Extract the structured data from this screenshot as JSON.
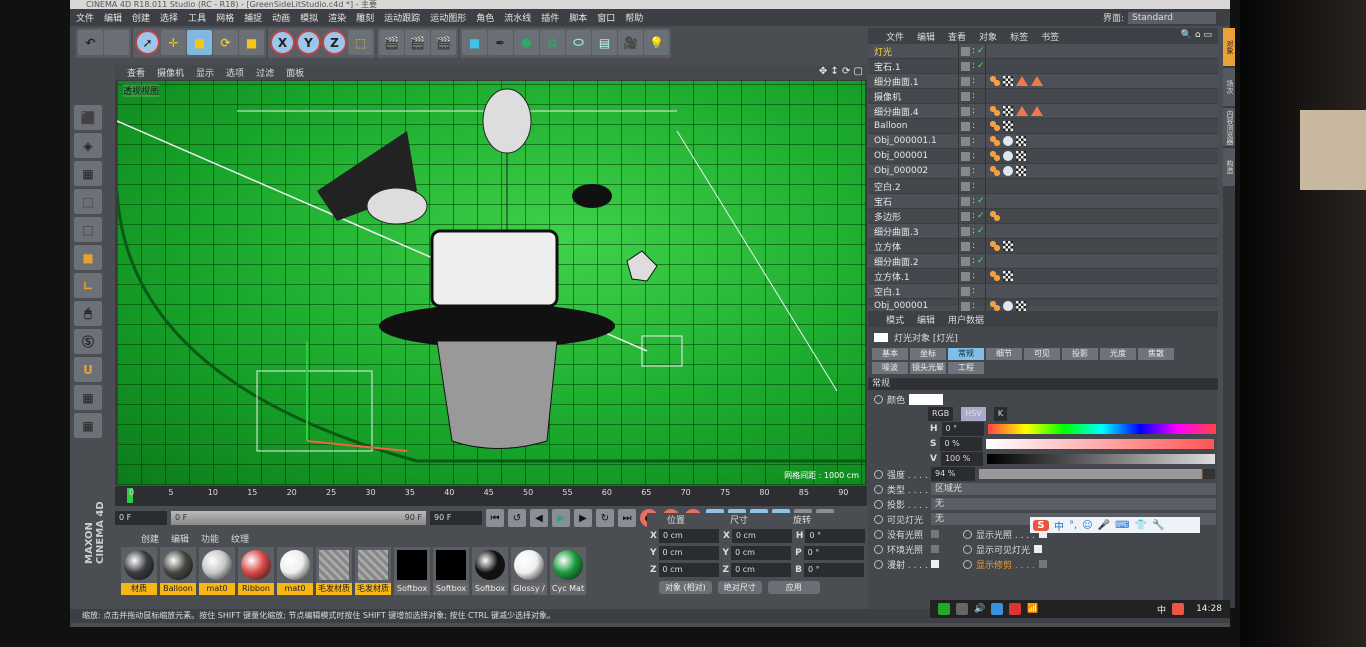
{
  "window": {
    "title": "CINEMA 4D R18.011 Studio (RC - R18) - [GreenSideLitStudio.c4d *] - 主要"
  },
  "menu": [
    "文件",
    "编辑",
    "创建",
    "选择",
    "工具",
    "网格",
    "捕捉",
    "动画",
    "模拟",
    "渲染",
    "雕刻",
    "运动跟踪",
    "运动图形",
    "角色",
    "流水线",
    "插件",
    "脚本",
    "窗口",
    "帮助"
  ],
  "layout": {
    "label": "界面:",
    "value": "Standard"
  },
  "toolbar": {
    "axes": [
      "X",
      "Y",
      "Z"
    ]
  },
  "viewport": {
    "menu": [
      "查看",
      "摄像机",
      "显示",
      "选项",
      "过滤",
      "面板"
    ],
    "label": "透视视图",
    "grid_spacing": "网格间距 : 1000 cm",
    "bg_color": "#22b534"
  },
  "timeline": {
    "ticks": [
      "0",
      "5",
      "10",
      "15",
      "20",
      "25",
      "30",
      "35",
      "40",
      "45",
      "50",
      "55",
      "60",
      "65",
      "70",
      "75",
      "80",
      "85",
      "90"
    ],
    "current_frame": "0 F",
    "start": "0 F",
    "slider_start": "0 F",
    "slider_end": "90 F",
    "end": "90 F"
  },
  "materials": {
    "menu": [
      "创建",
      "编辑",
      "功能",
      "纹理"
    ],
    "items": [
      {
        "name": "材质",
        "color": "#3a3c40",
        "sel": true
      },
      {
        "name": "Balloon",
        "color": "#45483f",
        "sel": true
      },
      {
        "name": "mat0",
        "color": "#c8c8c8",
        "sel": true
      },
      {
        "name": "Ribbon",
        "color": "#d84848",
        "sel": true
      },
      {
        "name": "mat0",
        "color": "#eeeeee",
        "sel": true
      },
      {
        "name": "毛发材质",
        "color": "hair",
        "sel": true
      },
      {
        "name": "毛发材质",
        "color": "hair",
        "sel": true
      },
      {
        "name": "Softbox",
        "color": "#000000",
        "sel": false
      },
      {
        "name": "Softbox",
        "color": "#000000",
        "sel": false
      },
      {
        "name": "Softbox",
        "color": "#111111",
        "sel": false
      },
      {
        "name": "Glossy /",
        "color": "#f0f0f0",
        "sel": false
      },
      {
        "name": "Cyc Mat",
        "color": "#1a9a3a",
        "sel": false
      }
    ]
  },
  "logo": "MAXON CINEMA 4D",
  "coords": {
    "headers": [
      "位置",
      "尺寸",
      "旋转"
    ],
    "rows": [
      {
        "a": "X",
        "av": "0 cm",
        "b": "X",
        "bv": "0 cm",
        "c": "H",
        "cv": "0 °"
      },
      {
        "a": "Y",
        "av": "0 cm",
        "b": "Y",
        "bv": "0 cm",
        "c": "P",
        "cv": "0 °"
      },
      {
        "a": "Z",
        "av": "0 cm",
        "b": "Z",
        "bv": "0 cm",
        "c": "B",
        "cv": "0 °"
      }
    ],
    "mode": "对象 (相对)",
    "size_mode": "绝对尺寸",
    "apply": "应用"
  },
  "status": "缩放: 点击并拖动鼠标缩放元素。按住 SHIFT 键量化缩放; 节点编辑模式时按住 SHIFT 键增加选择对象; 按住 CTRL 键减少选择对象。",
  "objects": {
    "menu": [
      "文件",
      "编辑",
      "查看",
      "对象",
      "标签",
      "书签"
    ],
    "items": [
      {
        "name": "灯光",
        "sel": true,
        "check": true,
        "tags": []
      },
      {
        "name": "宝石.1",
        "check": true,
        "tags": []
      },
      {
        "name": "细分曲面.1",
        "tags": [
          "phong",
          "tex",
          "tri",
          "tri"
        ]
      },
      {
        "name": "摄像机",
        "tags": []
      },
      {
        "name": "细分曲面.4",
        "tags": [
          "phong",
          "tex",
          "tri",
          "tri"
        ]
      },
      {
        "name": "Balloon",
        "tags": [
          "phong",
          "tex"
        ]
      },
      {
        "name": "Obj_000001.1",
        "tags": [
          "phong",
          "mball",
          "tex"
        ]
      },
      {
        "name": "Obj_000001",
        "tags": [
          "phong",
          "mball",
          "tex"
        ]
      },
      {
        "name": "Obj_000002",
        "tags": [
          "phong",
          "mball",
          "tex"
        ]
      },
      {
        "name": "空白.2",
        "tags": []
      },
      {
        "name": "宝石",
        "check": true,
        "tags": []
      },
      {
        "name": "多边形",
        "check": true,
        "tags": [
          "phong"
        ]
      },
      {
        "name": "细分曲面.3",
        "check": true,
        "tags": []
      },
      {
        "name": "立方体",
        "tags": [
          "phong",
          "tex"
        ]
      },
      {
        "name": "细分曲面.2",
        "check": true,
        "tags": []
      },
      {
        "name": "立方体.1",
        "tags": [
          "phong",
          "tex"
        ]
      },
      {
        "name": "空白.1",
        "tags": []
      },
      {
        "name": "Obj_000001",
        "tags": [
          "phong",
          "mball",
          "tex"
        ]
      }
    ]
  },
  "attributes": {
    "menu": [
      "模式",
      "编辑",
      "用户数据"
    ],
    "title": "灯光对象 [灯光]",
    "tabs": [
      "基本",
      "坐标",
      "常规",
      "细节",
      "可见",
      "投影",
      "光度",
      "焦散",
      "噪波",
      "镜头光晕",
      "工程"
    ],
    "active_tab": "常规",
    "section": "常规",
    "color_label": "颜色",
    "color_modes": [
      "RGB",
      "HSV",
      "K"
    ],
    "h": "0 °",
    "s": "0 %",
    "v": "100 %",
    "intensity_label": "强度 . . . .",
    "intensity": "94 %",
    "intensity_value": 94,
    "type_label": "类型 . . . .",
    "type": "区域光",
    "shadow_label": "投影 . . . .",
    "shadow": "无",
    "visible_label": "可见灯光",
    "visible": "无",
    "checks": [
      {
        "l": "没有光照",
        "v": false,
        "r": "显示光照 . . . .",
        "rv": true
      },
      {
        "l": "环境光照",
        "v": false,
        "r": "显示可见灯光",
        "rv": true
      },
      {
        "l": "漫射 . . . .",
        "v": true,
        "r": "显示修剪 . . . .",
        "rv": false
      }
    ]
  },
  "ime": {
    "lang": "中"
  },
  "right_tabs": [
    "对象",
    "场次",
    "内容浏览器",
    "构造"
  ],
  "taskbar": {
    "lang": "中",
    "time": "14:28"
  }
}
